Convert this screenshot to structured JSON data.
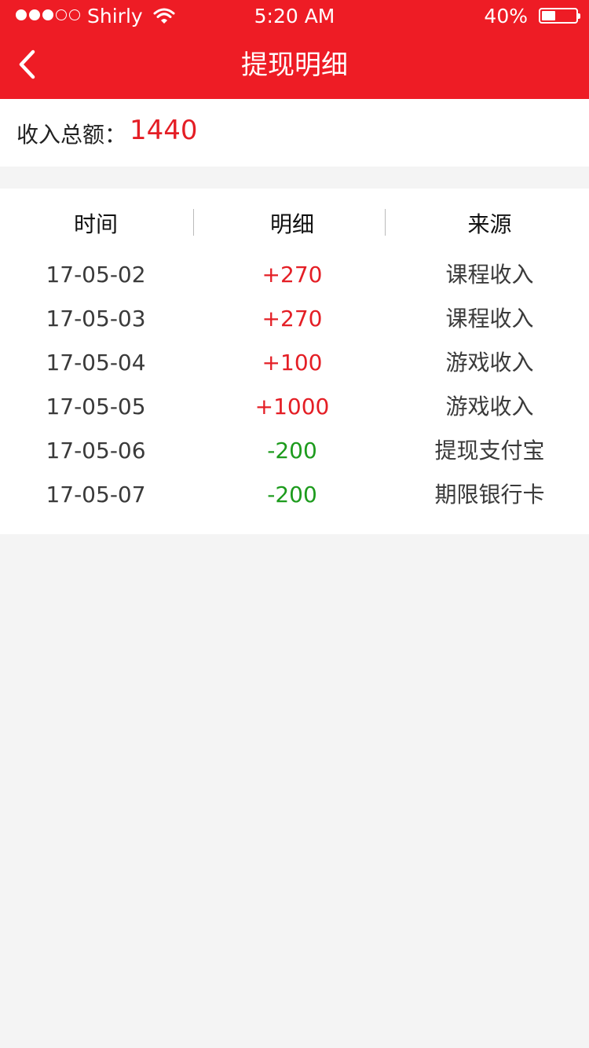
{
  "status_bar": {
    "carrier": "Shirly",
    "time": "5:20 AM",
    "battery_percent": "40%",
    "battery_level": 0.4,
    "signal_bars": 3,
    "signal_total": 5
  },
  "nav": {
    "title": "提现明细",
    "back_icon": "chevron-left-icon"
  },
  "summary": {
    "label": "收入总额：",
    "value": "1440"
  },
  "table": {
    "headers": [
      "时间",
      "明细",
      "来源"
    ],
    "rows": [
      {
        "date": "17-05-02",
        "amount": "+270",
        "source": "课程收入",
        "type": "pos"
      },
      {
        "date": "17-05-03",
        "amount": "+270",
        "source": "课程收入",
        "type": "pos"
      },
      {
        "date": "17-05-04",
        "amount": "+100",
        "source": "游戏收入",
        "type": "pos"
      },
      {
        "date": "17-05-05",
        "amount": "+1000",
        "source": "游戏收入",
        "type": "pos"
      },
      {
        "date": "17-05-06",
        "amount": "-200",
        "source": "提现支付宝",
        "type": "neg"
      },
      {
        "date": "17-05-07",
        "amount": "-200",
        "source": "期限银行卡",
        "type": "neg"
      }
    ]
  },
  "colors": {
    "brand_red": "#ee1c25",
    "positive": "#e41e25",
    "negative": "#1d9b1d",
    "background": "#f4f4f4"
  }
}
